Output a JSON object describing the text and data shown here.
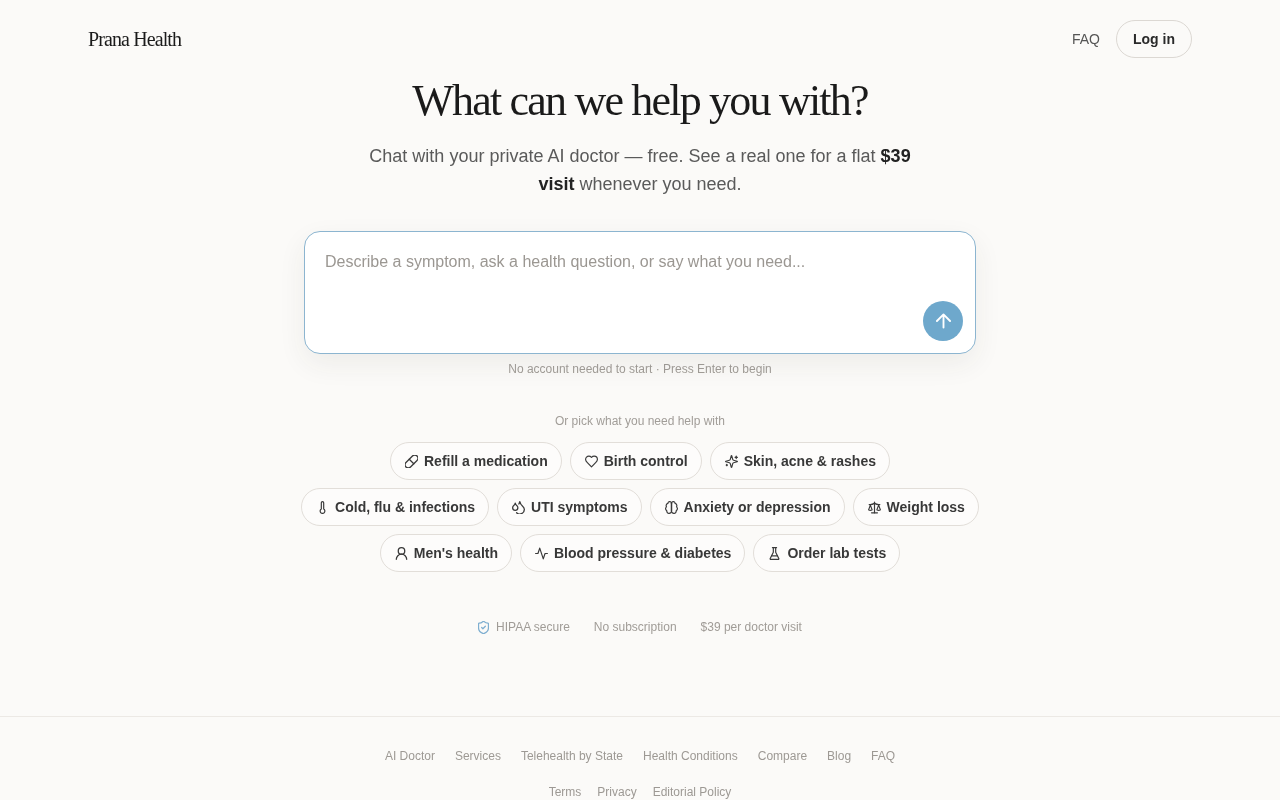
{
  "header": {
    "logo": "Prana Health",
    "faq": "FAQ",
    "login": "Log in"
  },
  "hero": {
    "title": "What can we help you with?",
    "subtitle": "Chat with your private AI doctor — free. See a real one for a flat **$39 visit** whenever you need."
  },
  "composer": {
    "placeholder": "Describe a symptom, ask a health question, or say what you need...",
    "hint": "No account needed to start · Press Enter to begin"
  },
  "topics": {
    "heading": "Or pick what you need help with",
    "rows": [
      [
        "Refill a medication",
        "Birth control",
        "Skin, acne & rashes"
      ],
      [
        "Cold, flu & infections",
        "UTI symptoms",
        "Anxiety or depression",
        "Weight loss"
      ],
      [
        "Men's health",
        "Blood pressure & diabetes",
        "Order lab tests"
      ]
    ]
  },
  "trust": [
    {
      "kind": "secure",
      "label": "HIPAA secure"
    },
    {
      "kind": "plain",
      "label": "No subscription"
    },
    {
      "kind": "plain",
      "label": "$39 per doctor visit"
    }
  ],
  "footer": {
    "links": [
      "AI Doctor",
      "Services",
      "Telehealth by State",
      "Health Conditions",
      "Compare",
      "Blog",
      "FAQ"
    ],
    "legal": [
      "Terms",
      "Privacy",
      "Editorial Policy"
    ]
  }
}
